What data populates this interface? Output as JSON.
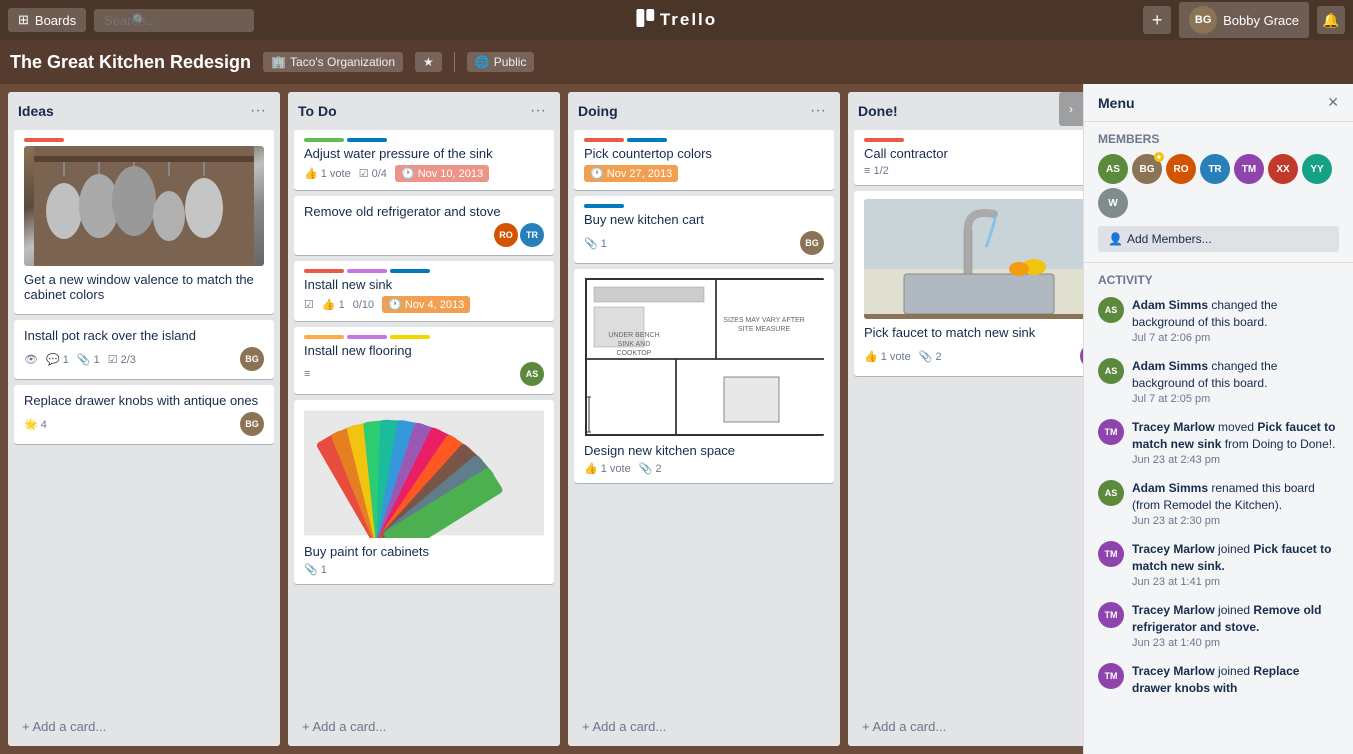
{
  "app": {
    "name": "Trello",
    "logo": "✦ Trello"
  },
  "nav": {
    "boards_label": "Boards",
    "search_placeholder": "Search...",
    "add_label": "+",
    "user_name": "Bobby Grace",
    "notification_icon": "🔔"
  },
  "board": {
    "title": "The Great Kitchen Redesign",
    "org": "Taco's Organization",
    "visibility": "Public",
    "is_starred": false
  },
  "lists": [
    {
      "id": "ideas",
      "title": "Ideas",
      "cards": [
        {
          "id": "c1",
          "title": "Get a new window valence to match the cabinet colors",
          "labels": [
            "red"
          ],
          "has_image": true,
          "image_type": "pots",
          "badges": {}
        },
        {
          "id": "c2",
          "title": "Install pot rack over the island",
          "labels": [],
          "badges": {
            "watching": true,
            "comments": 1,
            "attachments": 1,
            "checklist": "2/3"
          },
          "avatar": "BG"
        },
        {
          "id": "c3",
          "title": "Replace drawer knobs with antique ones",
          "labels": [],
          "badges": {
            "stickers": 4
          },
          "avatar": "BG"
        }
      ],
      "add_label": "Add a card..."
    },
    {
      "id": "todo",
      "title": "To Do",
      "cards": [
        {
          "id": "c4",
          "title": "Adjust water pressure of the sink",
          "labels": [
            "green",
            "blue"
          ],
          "badges": {
            "votes": "1 vote",
            "checklist": "0/4",
            "date": "Nov 10, 2013",
            "date_type": "red"
          }
        },
        {
          "id": "c5",
          "title": "Remove old refrigerator and stove",
          "labels": [],
          "badges": {},
          "avatars": [
            "RO",
            "TR"
          ]
        },
        {
          "id": "c6",
          "title": "Install new sink",
          "labels": [
            "red",
            "purple",
            "blue"
          ],
          "badges": {
            "checklist_icon": true,
            "votes": "1",
            "checklist": "0/10",
            "date": "Nov 4, 2013",
            "date_type": "orange"
          }
        },
        {
          "id": "c7",
          "title": "Install new flooring",
          "labels": [
            "orange",
            "purple",
            "yellow"
          ],
          "badges": {
            "description": true
          },
          "avatar": "AS"
        },
        {
          "id": "c8",
          "title": "Buy paint for cabinets",
          "labels": [],
          "has_image": true,
          "image_type": "swatches",
          "badges": {
            "attachments": 1
          }
        }
      ],
      "add_label": "Add a card..."
    },
    {
      "id": "doing",
      "title": "Doing",
      "cards": [
        {
          "id": "c9",
          "title": "Pick countertop colors",
          "labels": [
            "red",
            "blue"
          ],
          "badges": {
            "date": "Nov 27, 2013",
            "date_type": "orange"
          }
        },
        {
          "id": "c10",
          "title": "Buy new kitchen cart",
          "labels": [
            "blue"
          ],
          "badges": {
            "attachments": 1
          },
          "avatar": "BG"
        },
        {
          "id": "c11",
          "title": "Design new kitchen space",
          "labels": [],
          "has_image": true,
          "image_type": "floorplan",
          "badges": {
            "votes": "1 vote",
            "attachments": 2
          }
        }
      ],
      "add_label": "Add a card..."
    },
    {
      "id": "done",
      "title": "Done!",
      "cards": [
        {
          "id": "c12",
          "title": "Call contractor",
          "labels": [
            "red"
          ],
          "badges": {
            "checklist": "1/2"
          }
        },
        {
          "id": "c13",
          "title": "Pick faucet to match new sink",
          "labels": [],
          "has_image": true,
          "image_type": "kitchen",
          "badges": {
            "votes": "1 vote",
            "attachments": 2
          },
          "avatar": "TM"
        }
      ],
      "add_label": "Add a card..."
    }
  ],
  "menu": {
    "title": "Menu",
    "members_title": "Members",
    "add_members_label": "Add Members...",
    "activity_title": "Activity",
    "members": [
      {
        "initials": "AS",
        "color": "#5c8a3c"
      },
      {
        "initials": "BG",
        "color": "#8b7355"
      },
      {
        "initials": "RO",
        "color": "#d35400"
      },
      {
        "initials": "TR",
        "color": "#2980b9"
      },
      {
        "initials": "TM",
        "color": "#8e44ad"
      },
      {
        "initials": "XX",
        "color": "#c0392b"
      },
      {
        "initials": "YY",
        "color": "#16a085"
      },
      {
        "initials": "W",
        "color": "#7f8c8d"
      }
    ],
    "activities": [
      {
        "user": "Adam Simms",
        "action": "changed the background of this board.",
        "time": "Jul 7 at 2:06 pm",
        "initials": "AS",
        "color": "#5c8a3c"
      },
      {
        "user": "Adam Simms",
        "action": "changed the background of this board.",
        "time": "Jul 7 at 2:05 pm",
        "initials": "AS",
        "color": "#5c8a3c"
      },
      {
        "user": "Tracey Marlow",
        "action": "moved Pick faucet to match new sink from Doing to Done!.",
        "time": "Jun 23 at 2:43 pm",
        "initials": "TM",
        "color": "#8e44ad"
      },
      {
        "user": "Adam Simms",
        "action": "renamed this board (from Remodel the Kitchen).",
        "time": "Jun 23 at 2:30 pm",
        "initials": "AS",
        "color": "#5c8a3c"
      },
      {
        "user": "Tracey Marlow",
        "action": "joined Pick faucet to match new sink.",
        "time": "Jun 23 at 1:41 pm",
        "initials": "TM",
        "color": "#8e44ad"
      },
      {
        "user": "Tracey Marlow",
        "action": "joined Remove old refrigerator and stove.",
        "time": "Jun 23 at 1:40 pm",
        "initials": "TM",
        "color": "#8e44ad"
      },
      {
        "user": "Tracey Marlow",
        "action": "joined Replace drawer knobs with",
        "time": "",
        "initials": "TM",
        "color": "#8e44ad"
      }
    ]
  }
}
